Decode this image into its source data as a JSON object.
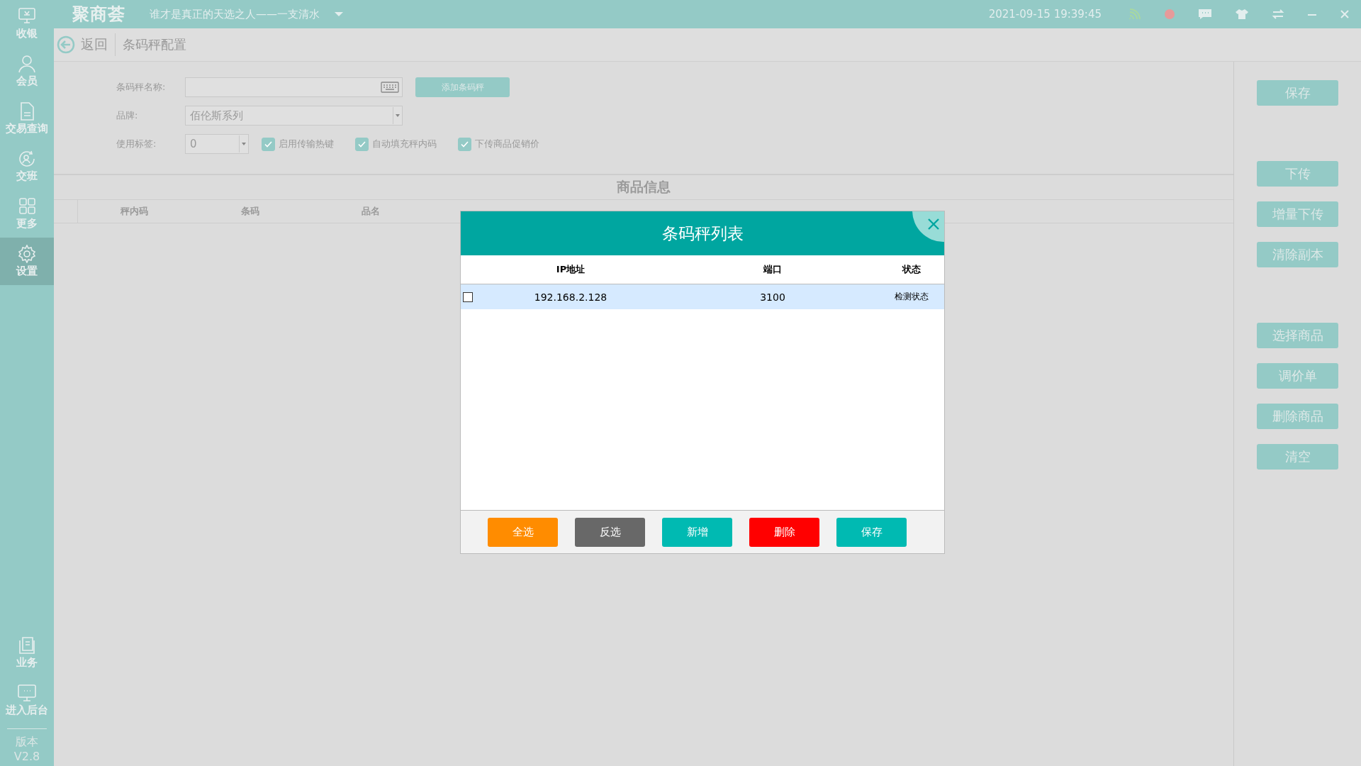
{
  "sidebar": {
    "items": [
      {
        "kind": "register",
        "label": "收银",
        "selected": false
      },
      {
        "kind": "member",
        "label": "会员",
        "selected": false
      },
      {
        "kind": "document",
        "label": "交易查询",
        "selected": false
      },
      {
        "kind": "shift",
        "label": "交班",
        "selected": false
      },
      {
        "kind": "grid",
        "label": "更多",
        "selected": false
      },
      {
        "kind": "gear",
        "label": "设置",
        "selected": true
      }
    ],
    "bottom_items": [
      {
        "kind": "book",
        "label": "业务"
      },
      {
        "kind": "monitor",
        "label": "进入后台"
      }
    ],
    "version": {
      "label": "版本",
      "value": "V2.8"
    }
  },
  "top_bar": {
    "logo": "聚商荟",
    "slogan": "谁才是真正的天选之人——一支清水",
    "datetime": "2021-09-15 19:39:45"
  },
  "sub_header": {
    "back": "返回",
    "title": "条码秤配置"
  },
  "form": {
    "name_label": "条码秤名称:",
    "add_button": "添加条码秤",
    "brand_label": "品牌:",
    "brand_value": "佰伦斯系列",
    "tag_label": "使用标签:",
    "tag_value": "0",
    "options": [
      {
        "label": "启用传输热键",
        "checked": true
      },
      {
        "label": "自动填充秤内码",
        "checked": true
      },
      {
        "label": "下传商品促销价",
        "checked": true
      }
    ]
  },
  "goods_table": {
    "title": "商品信息",
    "columns": [
      "秤内码",
      "条码",
      "品名"
    ]
  },
  "action_groups": [
    [
      "保存"
    ],
    [
      "下传",
      "增量下传",
      "清除副本"
    ],
    [
      "选择商品",
      "调价单",
      "删除商品",
      "清空"
    ]
  ],
  "dialog": {
    "title": "条码秤列表",
    "columns": [
      "IP地址",
      "端口",
      "状态"
    ],
    "rows": [
      {
        "checked": false,
        "selected": true,
        "ip": "192.168.2.128",
        "port": "3100",
        "status": "检测状态"
      }
    ],
    "buttons": [
      {
        "label": "全选",
        "kind": "orange"
      },
      {
        "label": "反选",
        "kind": "gray"
      },
      {
        "label": "新增",
        "kind": "teal"
      },
      {
        "label": "删除",
        "kind": "red"
      },
      {
        "label": "保存",
        "kind": "teal"
      }
    ]
  }
}
